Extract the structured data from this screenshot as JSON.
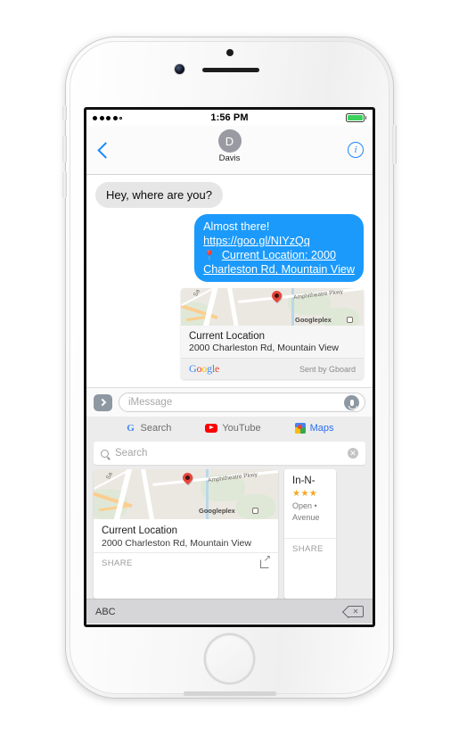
{
  "status_bar": {
    "signal_dots_filled": 4,
    "signal_dots_total": 5,
    "time": "1:56 PM",
    "battery_level_percent": 100
  },
  "nav_bar": {
    "back_icon": "chevron-left-icon",
    "avatar_initial": "D",
    "contact_name": "Davis",
    "info_icon": "info-circle-icon"
  },
  "conversation": {
    "incoming": {
      "text": "Hey, where are you?"
    },
    "outgoing": {
      "line1": "Almost there!",
      "link": "https://goo.gl/NIYzQq",
      "pin_emoji": "📍",
      "location_line": "Current Location: 2000",
      "location_line2": "Charleston Rd, Mountain View"
    },
    "map_card": {
      "title": "Current Location",
      "subtitle": "2000 Charleston Rd, Mountain View",
      "map_labels": {
        "road_sa": "Sa",
        "road_amphitheatre": "Amphitheatre Pkwy",
        "poi_googleplex": "Googleplex"
      },
      "brand": "Google",
      "brand_letters": [
        "G",
        "o",
        "o",
        "g",
        "l",
        "e"
      ],
      "attribution": "Sent by Gboard"
    }
  },
  "input_bar": {
    "apps_button_icon": "chevron-right-icon",
    "placeholder": "iMessage",
    "mic_icon": "microphone-icon"
  },
  "gboard": {
    "tabs": [
      {
        "label": "Search",
        "icon": "google-g-icon",
        "active": false
      },
      {
        "label": "YouTube",
        "icon": "youtube-icon",
        "active": false
      },
      {
        "label": "Maps",
        "icon": "google-maps-icon",
        "active": true
      }
    ],
    "search": {
      "placeholder": "Search",
      "value": "",
      "search_icon": "magnifier-icon",
      "clear_icon": "clear-circle-icon"
    },
    "results": [
      {
        "title": "Current Location",
        "subtitle": "2000 Charleston Rd, Mountain View",
        "share_label": "SHARE",
        "open_icon": "external-link-icon",
        "map_labels": {
          "road_sa": "Sa",
          "road_amphitheatre": "Amphitheatre Pkwy",
          "poi_googleplex": "Googleplex"
        }
      },
      {
        "title": "In-N-",
        "stars": "★★★",
        "line1": "Open •",
        "line2": "Avenue",
        "share_label": "SHARE"
      }
    ],
    "bottom_bar": {
      "abc_label": "ABC",
      "delete_icon": "backspace-icon"
    }
  },
  "colors": {
    "imessage_blue": "#1b9afb",
    "tint_blue": "#1b8afb",
    "incoming_gray": "#e6e6e6",
    "keyboard_gray": "#ececec",
    "battery_green": "#3bd25c",
    "star_orange": "#f5a623",
    "pin_red": "#e8453c"
  }
}
